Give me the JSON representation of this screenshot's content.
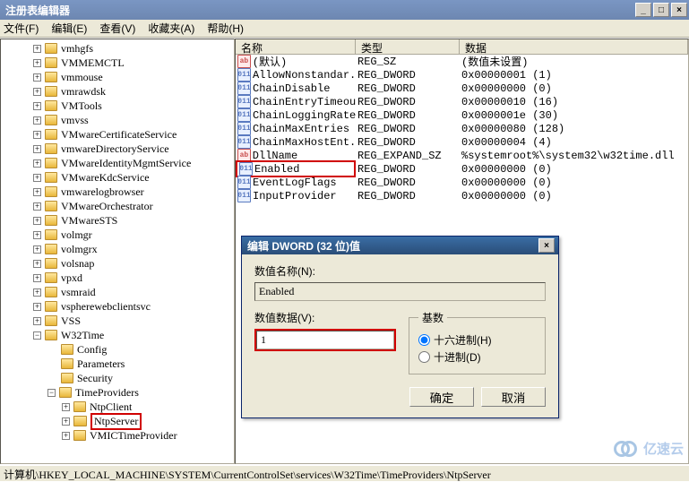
{
  "window": {
    "title": "注册表编辑器"
  },
  "menu": {
    "file": "文件(F)",
    "edit": "编辑(E)",
    "view": "查看(V)",
    "fav": "收藏夹(A)",
    "help": "帮助(H)"
  },
  "tree": [
    {
      "d": 2,
      "exp": "+",
      "label": "vmhgfs"
    },
    {
      "d": 2,
      "exp": "+",
      "label": "VMMEMCTL"
    },
    {
      "d": 2,
      "exp": "+",
      "label": "vmmouse"
    },
    {
      "d": 2,
      "exp": "+",
      "label": "vmrawdsk"
    },
    {
      "d": 2,
      "exp": "+",
      "label": "VMTools"
    },
    {
      "d": 2,
      "exp": "+",
      "label": "vmvss"
    },
    {
      "d": 2,
      "exp": "+",
      "label": "VMwareCertificateService"
    },
    {
      "d": 2,
      "exp": "+",
      "label": "vmwareDirectoryService"
    },
    {
      "d": 2,
      "exp": "+",
      "label": "VMwareIdentityMgmtService"
    },
    {
      "d": 2,
      "exp": "+",
      "label": "VMwareKdcService"
    },
    {
      "d": 2,
      "exp": "+",
      "label": "vmwarelogbrowser"
    },
    {
      "d": 2,
      "exp": "+",
      "label": "VMwareOrchestrator"
    },
    {
      "d": 2,
      "exp": "+",
      "label": "VMwareSTS"
    },
    {
      "d": 2,
      "exp": "+",
      "label": "volmgr"
    },
    {
      "d": 2,
      "exp": "+",
      "label": "volmgrx"
    },
    {
      "d": 2,
      "exp": "+",
      "label": "volsnap"
    },
    {
      "d": 2,
      "exp": "+",
      "label": "vpxd"
    },
    {
      "d": 2,
      "exp": "+",
      "label": "vsmraid"
    },
    {
      "d": 2,
      "exp": "+",
      "label": "vspherewebclientsvc"
    },
    {
      "d": 2,
      "exp": "+",
      "label": "VSS"
    },
    {
      "d": 2,
      "exp": "-",
      "label": "W32Time"
    },
    {
      "d": 3,
      "exp": "",
      "label": "Config"
    },
    {
      "d": 3,
      "exp": "",
      "label": "Parameters"
    },
    {
      "d": 3,
      "exp": "",
      "label": "Security"
    },
    {
      "d": 3,
      "exp": "-",
      "label": "TimeProviders"
    },
    {
      "d": 4,
      "exp": "+",
      "label": "NtpClient"
    },
    {
      "d": 4,
      "exp": "+",
      "label": "NtpServer",
      "hl": true,
      "open": true
    },
    {
      "d": 4,
      "exp": "+",
      "label": "VMICTimeProvider"
    }
  ],
  "list": {
    "headers": {
      "name": "名称",
      "type": "类型",
      "data": "数据"
    },
    "rows": [
      {
        "icon": "str",
        "name": "(默认)",
        "type": "REG_SZ",
        "data": "(数值未设置)"
      },
      {
        "icon": "bin",
        "name": "AllowNonstandar...",
        "type": "REG_DWORD",
        "data": "0x00000001 (1)"
      },
      {
        "icon": "bin",
        "name": "ChainDisable",
        "type": "REG_DWORD",
        "data": "0x00000000 (0)"
      },
      {
        "icon": "bin",
        "name": "ChainEntryTimeout",
        "type": "REG_DWORD",
        "data": "0x00000010 (16)"
      },
      {
        "icon": "bin",
        "name": "ChainLoggingRate",
        "type": "REG_DWORD",
        "data": "0x0000001e (30)"
      },
      {
        "icon": "bin",
        "name": "ChainMaxEntries",
        "type": "REG_DWORD",
        "data": "0x00000080 (128)"
      },
      {
        "icon": "bin",
        "name": "ChainMaxHostEnt...",
        "type": "REG_DWORD",
        "data": "0x00000004 (4)"
      },
      {
        "icon": "str",
        "name": "DllName",
        "type": "REG_EXPAND_SZ",
        "data": "%systemroot%\\system32\\w32time.dll"
      },
      {
        "icon": "bin",
        "name": "Enabled",
        "type": "REG_DWORD",
        "data": "0x00000000 (0)",
        "hl": true
      },
      {
        "icon": "bin",
        "name": "EventLogFlags",
        "type": "REG_DWORD",
        "data": "0x00000000 (0)"
      },
      {
        "icon": "bin",
        "name": "InputProvider",
        "type": "REG_DWORD",
        "data": "0x00000000 (0)"
      }
    ]
  },
  "dialog": {
    "title": "编辑 DWORD (32 位)值",
    "name_label": "数值名称(N):",
    "name_value": "Enabled",
    "data_label": "数值数据(V):",
    "data_value": "1",
    "radix_label": "基数",
    "radix_hex": "十六进制(H)",
    "radix_dec": "十进制(D)",
    "ok": "确定",
    "cancel": "取消"
  },
  "statusbar": "计算机\\HKEY_LOCAL_MACHINE\\SYSTEM\\CurrentControlSet\\services\\W32Time\\TimeProviders\\NtpServer",
  "watermark": "亿速云"
}
